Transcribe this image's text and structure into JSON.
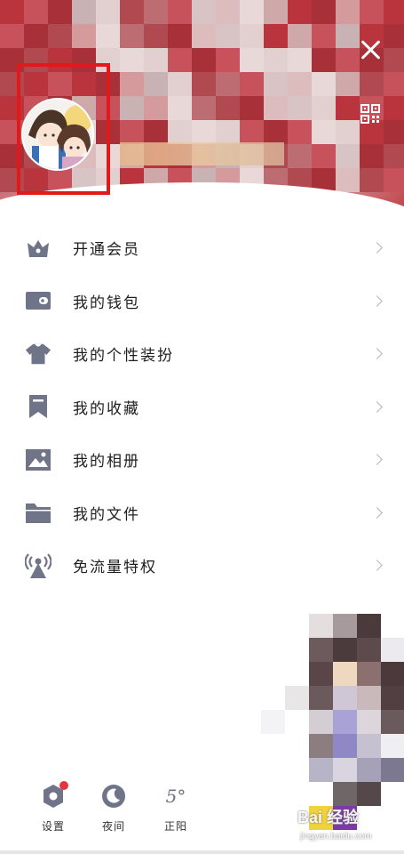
{
  "header": {
    "close_icon": "close-icon",
    "qr_icon": "qr-code-icon",
    "accent_color": "#c43a44",
    "highlight_box_color": "#e01a1a"
  },
  "menu": {
    "items": [
      {
        "label": "开通会员",
        "icon": "crown-icon"
      },
      {
        "label": "我的钱包",
        "icon": "wallet-icon"
      },
      {
        "label": "我的个性装扮",
        "icon": "shirt-icon"
      },
      {
        "label": "我的收藏",
        "icon": "bookmark-icon"
      },
      {
        "label": "我的相册",
        "icon": "photo-icon"
      },
      {
        "label": "我的文件",
        "icon": "folder-icon"
      },
      {
        "label": "免流量特权",
        "icon": "antenna-icon"
      }
    ],
    "icon_color": "#6f7488"
  },
  "bottom": {
    "settings_label": "设置",
    "night_label": "夜间",
    "weather_temp": "5°",
    "weather_label": "正阳"
  },
  "watermark": {
    "text": "Bai 经验",
    "sub": "jingyan.baidu.com"
  }
}
